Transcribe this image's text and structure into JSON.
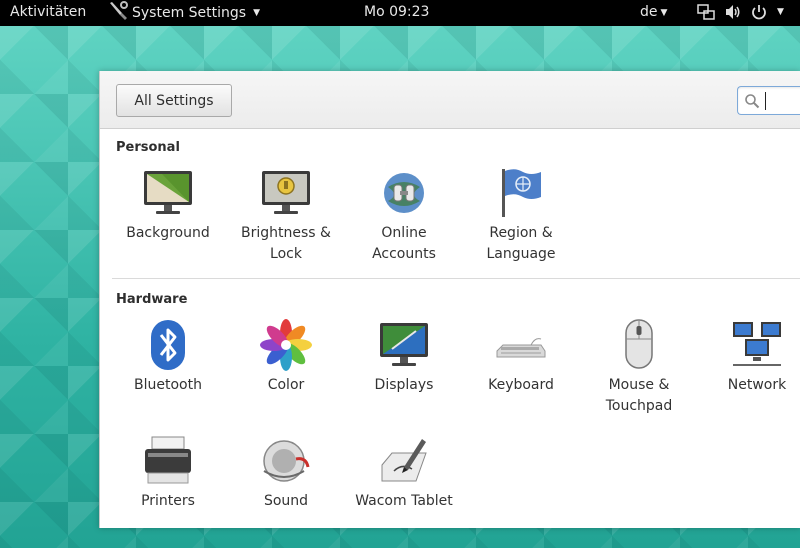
{
  "topbar": {
    "activities": "Aktivitäten",
    "app_menu": "System Settings",
    "clock": "Mo 09:23",
    "language": "de"
  },
  "toolbar": {
    "all_settings": "All Settings",
    "search_value": ""
  },
  "sections": {
    "personal": {
      "title": "Personal",
      "items": [
        {
          "label": "Background",
          "icon": "background-icon"
        },
        {
          "label": "Brightness &\nLock",
          "icon": "brightness-lock-icon"
        },
        {
          "label": "Online\nAccounts",
          "icon": "online-accounts-icon"
        },
        {
          "label": "Region &\nLanguage",
          "icon": "region-language-icon"
        }
      ]
    },
    "hardware": {
      "title": "Hardware",
      "items": [
        {
          "label": "Bluetooth",
          "icon": "bluetooth-icon"
        },
        {
          "label": "Color",
          "icon": "color-icon"
        },
        {
          "label": "Displays",
          "icon": "displays-icon"
        },
        {
          "label": "Keyboard",
          "icon": "keyboard-icon"
        },
        {
          "label": "Mouse &\nTouchpad",
          "icon": "mouse-touchpad-icon"
        },
        {
          "label": "Network",
          "icon": "network-icon"
        },
        {
          "label": "Printers",
          "icon": "printers-icon"
        },
        {
          "label": "Sound",
          "icon": "sound-icon"
        },
        {
          "label": "Wacom Tablet",
          "icon": "wacom-tablet-icon"
        }
      ]
    }
  },
  "colors": {
    "topbar": "#000000",
    "wallpaper": "#3fbfae",
    "search_focus": "#7da9d9"
  }
}
